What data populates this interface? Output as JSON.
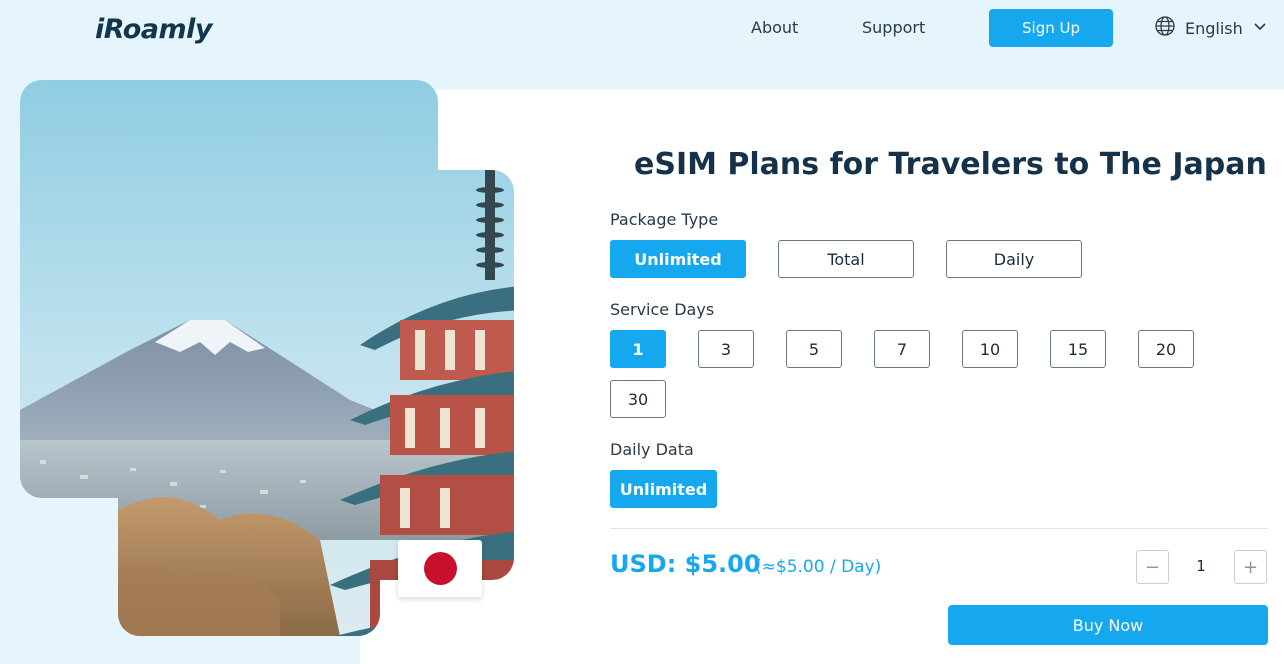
{
  "header": {
    "logo": "iRoamly",
    "nav": [
      {
        "label": "About"
      },
      {
        "label": "Support"
      }
    ],
    "signup_label": "Sign Up",
    "language": "English"
  },
  "hero": {
    "flag_country": "Japan"
  },
  "plan": {
    "title": "eSIM Plans for Travelers to The Japan",
    "package_type_label": "Package Type",
    "package_types": [
      "Unlimited",
      "Total",
      "Daily"
    ],
    "package_selected": "Unlimited",
    "service_days_label": "Service Days",
    "service_days": [
      "1",
      "3",
      "5",
      "7",
      "10",
      "15",
      "20",
      "30"
    ],
    "service_days_selected": "1",
    "daily_data_label": "Daily Data",
    "daily_data_options": [
      "Unlimited"
    ],
    "daily_data_selected": "Unlimited"
  },
  "purchase": {
    "price": "USD: $5.00",
    "per_day": "(≈$5.00 / Day)",
    "quantity": "1",
    "decrement_symbol": "−",
    "increment_symbol": "+",
    "buy_label": "Buy Now"
  },
  "colors": {
    "accent": "#16a8ef",
    "background": "#e6f4fc",
    "title": "#16324a"
  },
  "icons": {
    "language": "globe-icon",
    "language_chevron": "chevron-down-icon"
  }
}
